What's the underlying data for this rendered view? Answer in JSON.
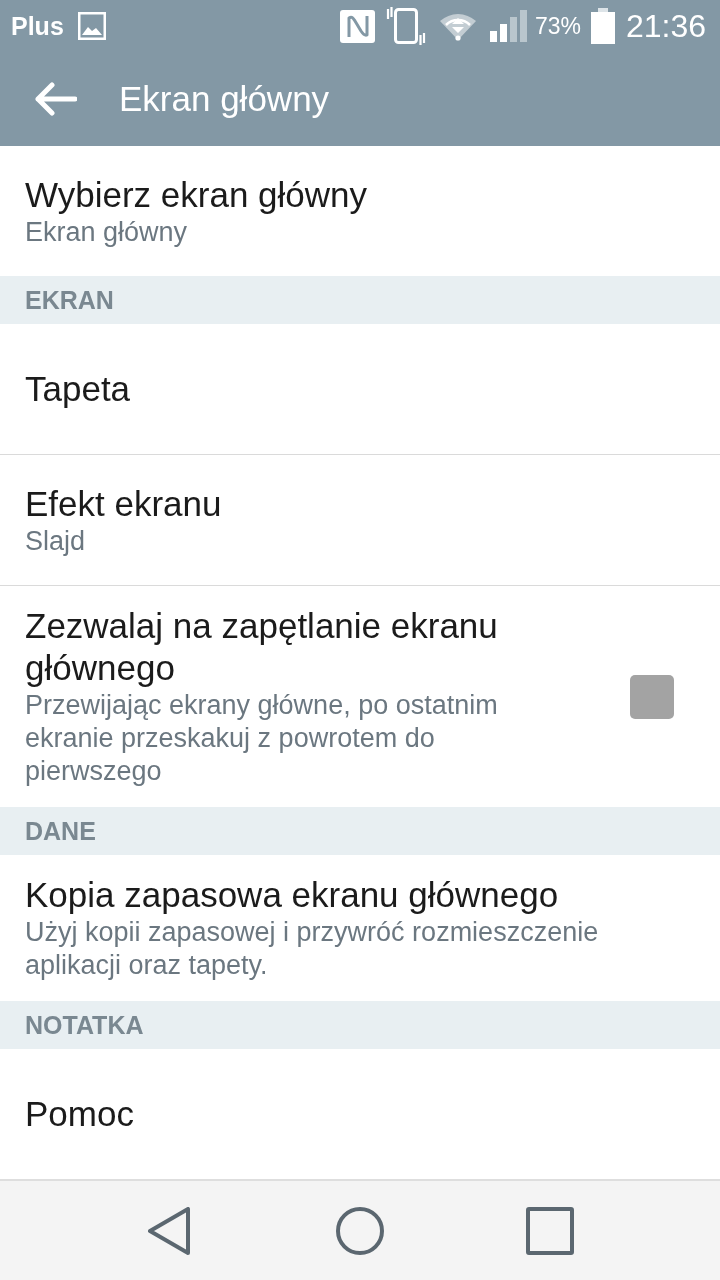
{
  "status_bar": {
    "carrier": "Plus",
    "battery_percent": "73%",
    "time": "21:36"
  },
  "toolbar": {
    "title": "Ekran główny"
  },
  "settings": [
    {
      "kind": "item",
      "title": "Wybierz ekran główny",
      "summary": "Ekran główny"
    },
    {
      "kind": "header",
      "title": "EKRAN"
    },
    {
      "kind": "item",
      "title": "Tapeta"
    },
    {
      "kind": "item",
      "title": "Efekt ekranu",
      "summary": "Slajd"
    },
    {
      "kind": "checkbox",
      "title": "Zezwalaj na zapętlanie ekranu głównego",
      "summary": "Przewijając ekrany główne, po ostatnim ekranie przeskakuj z powrotem do pierwszego",
      "checked": false
    },
    {
      "kind": "header",
      "title": "DANE"
    },
    {
      "kind": "item",
      "title": "Kopia zapasowa ekranu głównego",
      "summary": "Użyj kopii zapasowej i przywróć rozmieszczenie aplikacji oraz tapety."
    },
    {
      "kind": "header",
      "title": "NOTATKA"
    },
    {
      "kind": "item",
      "title": "Pomoc"
    }
  ]
}
